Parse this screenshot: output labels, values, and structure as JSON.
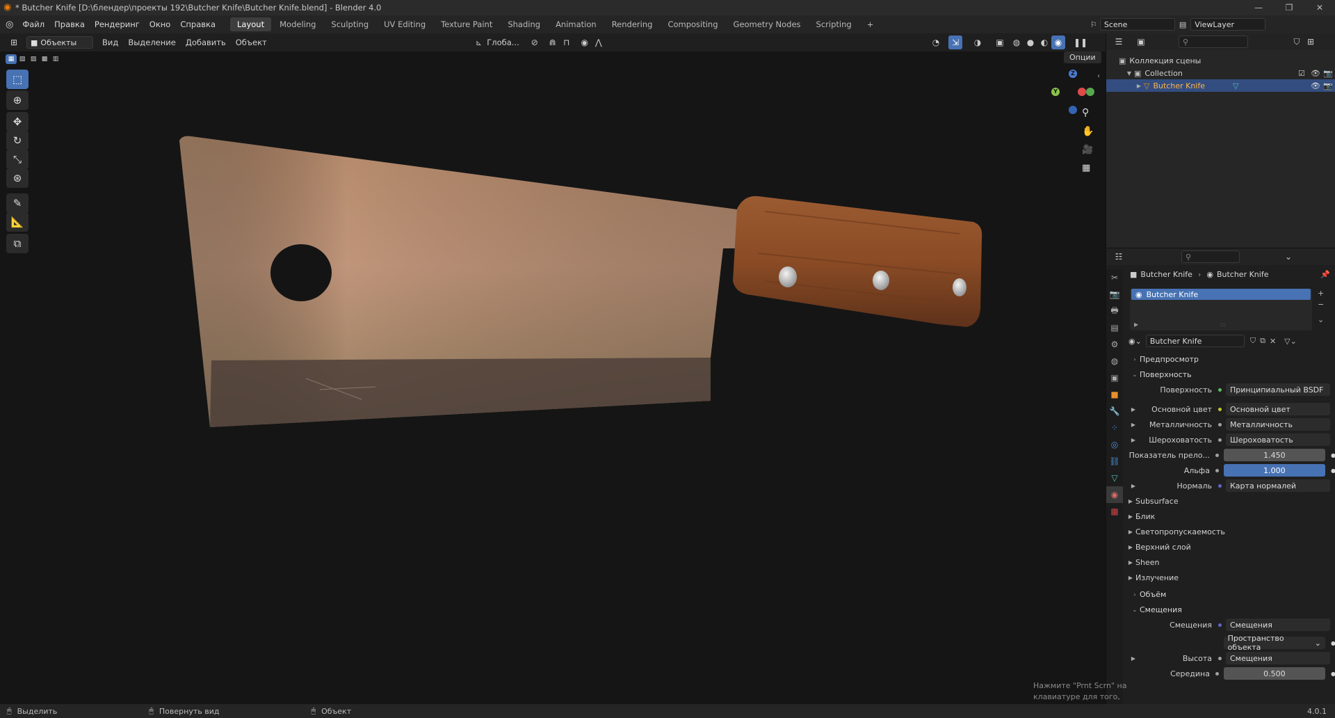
{
  "window": {
    "title": "* Butcher Knife [D:\\блендер\\проекты 192\\Butcher Knife\\Butcher Knife.blend] - Blender 4.0"
  },
  "menu": [
    "Файл",
    "Правка",
    "Рендеринг",
    "Окно",
    "Справка"
  ],
  "workspaces": [
    "Layout",
    "Modeling",
    "Sculpting",
    "UV Editing",
    "Texture Paint",
    "Shading",
    "Animation",
    "Rendering",
    "Compositing",
    "Geometry Nodes",
    "Scripting"
  ],
  "active_workspace": "Layout",
  "scene": {
    "name": "Scene",
    "view_layer": "ViewLayer"
  },
  "viewport_header": {
    "mode": "Объекты",
    "items": [
      "Вид",
      "Выделение",
      "Добавить",
      "Объект"
    ],
    "orientation": "Глоба...",
    "options": "Опции"
  },
  "outliner": {
    "scene_collection": "Коллекция сцены",
    "collection": "Collection",
    "object": "Butcher Knife"
  },
  "properties": {
    "breadcrumb": [
      "Butcher Knife",
      "Butcher Knife"
    ],
    "material_slot": "Butcher Knife",
    "material_name": "Butcher Knife",
    "panels": {
      "preview": "Предпросмотр",
      "surface": "Поверхность",
      "volume": "Объём",
      "displacement": "Смещения"
    },
    "surface_rows": [
      {
        "label": "Поверхность",
        "value": "Принципиальный BSDF",
        "dot": "#5dbb63",
        "expand": false
      },
      {
        "label": "Основной цвет",
        "value": "Основной цвет",
        "dot": "#c7c729",
        "expand": true
      },
      {
        "label": "Металличность",
        "value": "Металличность",
        "dot": "#a1a1a1",
        "expand": true
      },
      {
        "label": "Шероховатость",
        "value": "Шероховатость",
        "dot": "#a1a1a1",
        "expand": true
      },
      {
        "label": "Показатель прело...",
        "value": "1.450",
        "dot": "#a1a1a1",
        "expand": false,
        "kind": "num"
      },
      {
        "label": "Альфа",
        "value": "1.000",
        "dot": "#a1a1a1",
        "expand": false,
        "kind": "blue"
      },
      {
        "label": "Нормаль",
        "value": "Карта нормалей",
        "dot": "#6363c7",
        "expand": true
      }
    ],
    "subsections": [
      "Subsurface",
      "Блик",
      "Светопропускаемость",
      "Верхний слой",
      "Sheen",
      "Излучение"
    ],
    "displacement_rows": {
      "label": "Смещения",
      "value": "Смещения",
      "space": "Пространство объекта",
      "height_label": "Высота",
      "height_value": "Смещения",
      "midlevel_label": "Середина",
      "midlevel_value": "0.500"
    }
  },
  "status_bar": {
    "select": "Выделить",
    "rotate": "Повернуть вид",
    "object": "Объект",
    "version": "4.0.1"
  },
  "notice": "Нажмите \"Prnt Scrn\" на клавиатуре для того, чтобы сделать скриншот",
  "colors": {
    "accent": "#4772b3",
    "viewport_bg": "#151515",
    "panel_bg": "#1f1f1f"
  }
}
